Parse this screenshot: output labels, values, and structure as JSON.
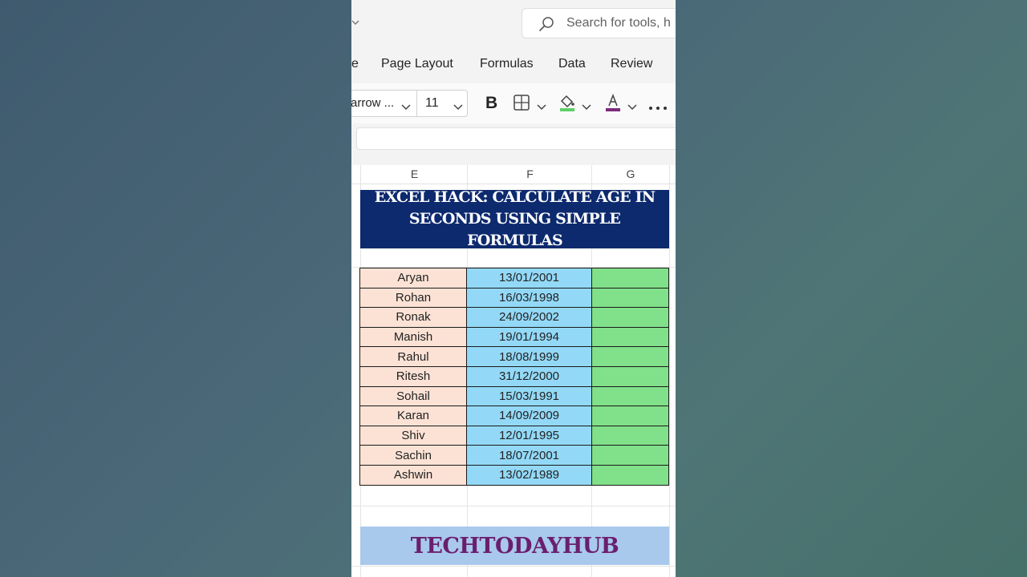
{
  "search": {
    "placeholder": "Search for tools, h"
  },
  "ribbon_tabs": [
    {
      "label": "e"
    },
    {
      "label": "Page Layout"
    },
    {
      "label": "Formulas"
    },
    {
      "label": "Data"
    },
    {
      "label": "Review"
    }
  ],
  "toolbar": {
    "font_name": "arrow ...",
    "font_size": "11",
    "fill_color": "#5fcf6a",
    "font_color": "#7b2a7d"
  },
  "columns": [
    {
      "letter": "E"
    },
    {
      "letter": "F"
    },
    {
      "letter": "G"
    }
  ],
  "banner": {
    "title": "EXCEL HACK: CALCULATE AGE IN SECONDS USING SIMPLE FORMULAS",
    "background": "#0d2a6e"
  },
  "rows": [
    {
      "name": "Aryan",
      "dob": "13/01/2001"
    },
    {
      "name": "Rohan",
      "dob": "16/03/1998"
    },
    {
      "name": "Ronak",
      "dob": "24/09/2002"
    },
    {
      "name": "Manish",
      "dob": "19/01/1994"
    },
    {
      "name": "Rahul",
      "dob": "18/08/1999"
    },
    {
      "name": "Ritesh",
      "dob": "31/12/2000"
    },
    {
      "name": "Sohail",
      "dob": "15/03/1991"
    },
    {
      "name": "Karan",
      "dob": "14/09/2009"
    },
    {
      "name": "Shiv",
      "dob": "12/01/1995"
    },
    {
      "name": "Sachin",
      "dob": "18/07/2001"
    },
    {
      "name": "Ashwin",
      "dob": "13/02/1989"
    }
  ],
  "colors": {
    "name_fill": "#fbe2d5",
    "date_fill": "#93d9f7",
    "result_fill": "#81e08a"
  },
  "brand": {
    "text": "TECHTODAYHUB",
    "background": "#a9c9ec",
    "color": "#6a1f6e"
  }
}
